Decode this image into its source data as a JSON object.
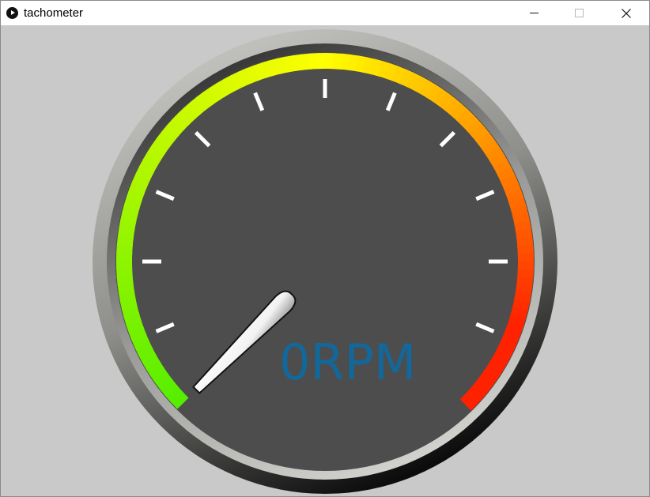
{
  "window": {
    "title": "tachometer",
    "app_icon": "play-circle-icon",
    "controls": {
      "minimize_icon": "minimize-icon",
      "maximize_icon": "maximize-icon",
      "close_icon": "close-icon"
    }
  },
  "tachometer": {
    "readout": "0RPM",
    "needle_level": 0,
    "tick_count": 11,
    "colors": {
      "background": "#c9c9c9",
      "dial_face": "#4d4d4d",
      "readout_text": "#12689a",
      "ticks": "#ffffff",
      "arc_start": "#55ee00",
      "arc_middle": "#ffff00",
      "arc_orange": "#ff8800",
      "arc_end": "#ff2200"
    }
  }
}
